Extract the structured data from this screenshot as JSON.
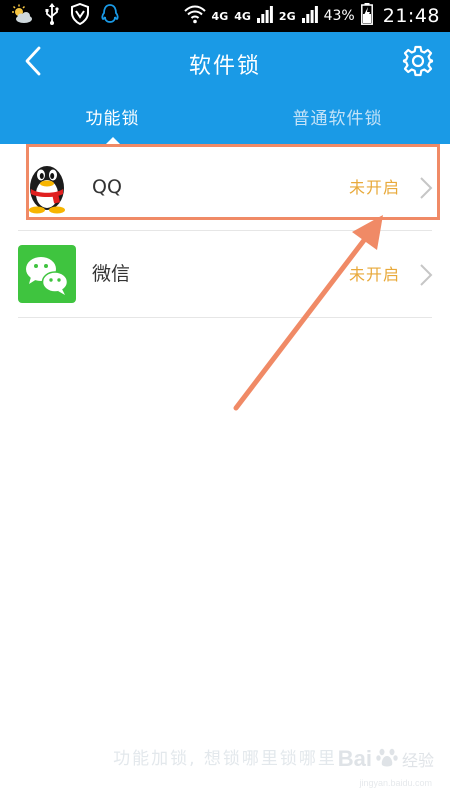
{
  "status_bar": {
    "network_1": "4G",
    "network_2": "4G",
    "network_3": "2G",
    "battery_percent": "43%",
    "time": "21:48",
    "icons": [
      "weather-icon",
      "usb-icon",
      "vpn-shield-icon",
      "qq-notification-icon",
      "wifi-icon",
      "signal-icon",
      "battery-charging-icon"
    ]
  },
  "app_bar": {
    "title": "软件锁",
    "back_icon": "chevron-left-icon",
    "settings_icon": "gear-icon"
  },
  "tabs": [
    {
      "label": "功能锁",
      "active": true
    },
    {
      "label": "普通软件锁",
      "active": false
    }
  ],
  "apps": [
    {
      "name": "QQ",
      "status": "未开启",
      "icon": "qq-penguin-icon"
    },
    {
      "name": "微信",
      "status": "未开启",
      "icon": "wechat-icon"
    }
  ],
  "footer": {
    "caption": "功能加锁, 想锁哪里锁哪里",
    "watermark_text": "Bai",
    "watermark_sub": "经验",
    "watermark_url": "jingyan.baidu.com"
  },
  "colors": {
    "primary": "#1a9ae6",
    "status_text": "#e8a93a",
    "annotation": "#f08a66"
  }
}
